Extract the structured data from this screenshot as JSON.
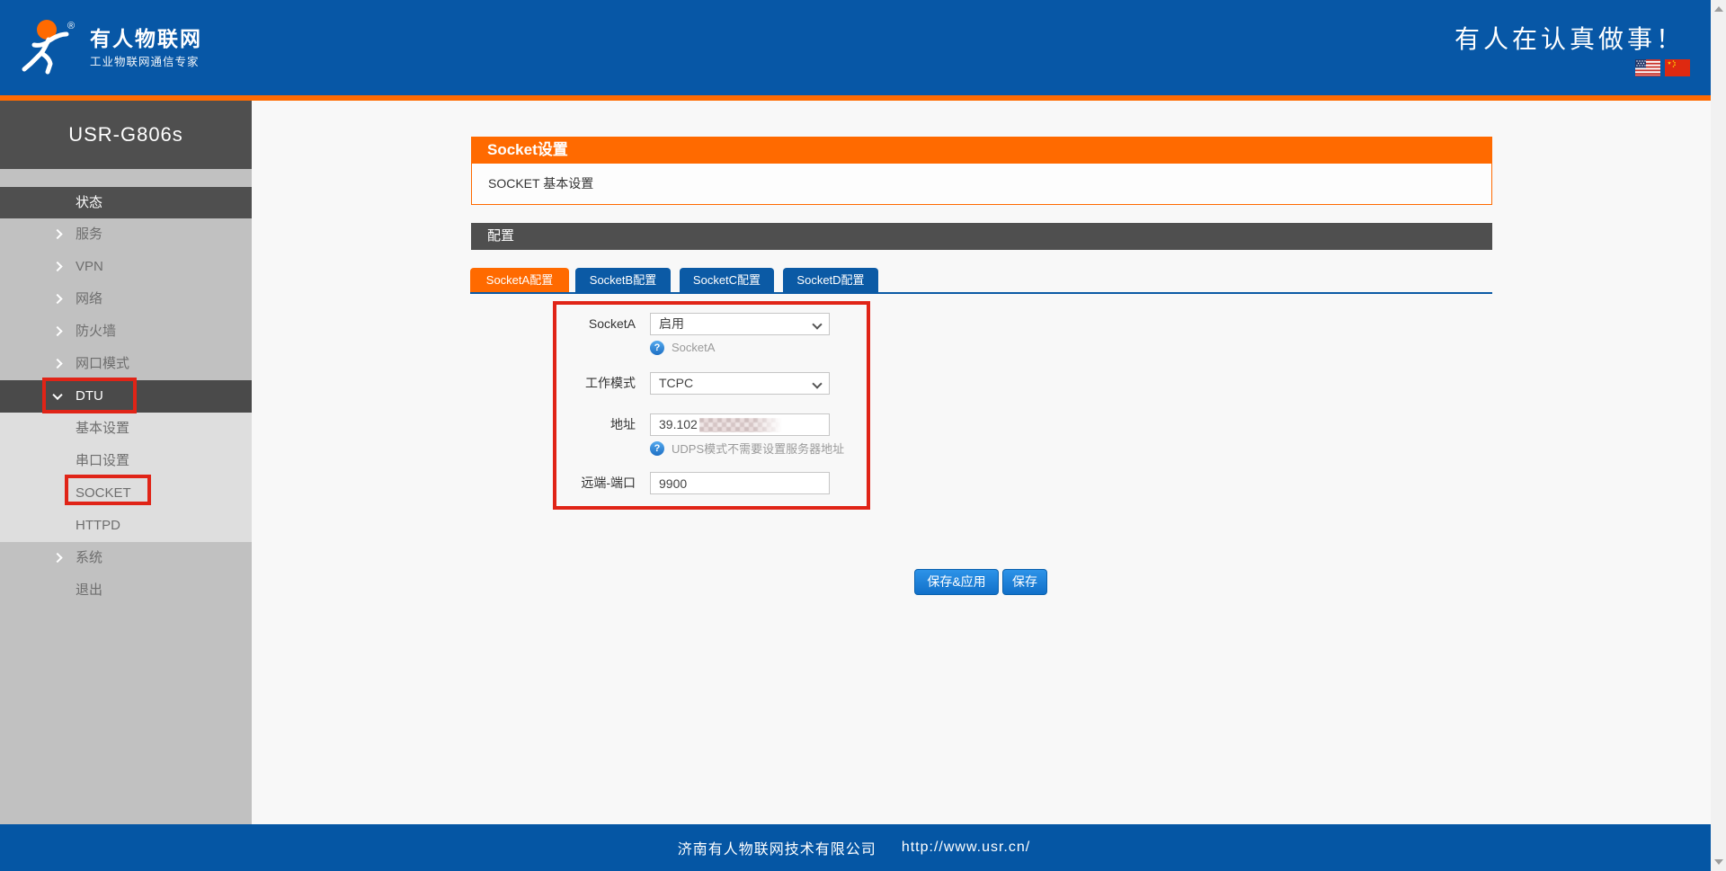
{
  "brand": {
    "name": "有人物联网",
    "subtitle": "工业物联网通信专家",
    "registered_mark": "®",
    "slogan": "有人在认真做事！"
  },
  "colors": {
    "header_blue": "#0757A6",
    "accent_orange": "#FF6A00",
    "dark_bar": "#4F4F4F",
    "tab_blue": "#0B5AA5",
    "annotation_red": "#E02417",
    "footer_blue": "#0556A4"
  },
  "sidebar": {
    "device_title": "USR-G806s",
    "items": [
      {
        "label": "状态"
      },
      {
        "label": "服务"
      },
      {
        "label": "VPN"
      },
      {
        "label": "网络"
      },
      {
        "label": "防火墙"
      },
      {
        "label": "网口模式"
      },
      {
        "label": "DTU"
      },
      {
        "label": "基本设置"
      },
      {
        "label": "串口设置"
      },
      {
        "label": "SOCKET"
      },
      {
        "label": "HTTPD"
      },
      {
        "label": "系统"
      },
      {
        "label": "退出"
      }
    ]
  },
  "main": {
    "panel_title": "Socket设置",
    "panel_subtitle": "SOCKET 基本设置",
    "config_title": "配置",
    "tabs": [
      {
        "label": "SocketA配置"
      },
      {
        "label": "SocketB配置"
      },
      {
        "label": "SocketC配置"
      },
      {
        "label": "SocketD配置"
      }
    ],
    "form": {
      "socket_enable": {
        "label": "SocketA",
        "value": "启用",
        "help": "SocketA"
      },
      "work_mode": {
        "label": "工作模式",
        "value": "TCPC"
      },
      "address": {
        "label": "地址",
        "value": "39.102",
        "help": "UDPS模式不需要设置服务器地址"
      },
      "remote_port": {
        "label": "远端-端口",
        "value": "9900"
      }
    },
    "buttons": {
      "save_apply": "保存&应用",
      "save": "保存"
    },
    "help_icon_glyph": "?"
  },
  "footer": {
    "company": "济南有人物联网技术有限公司",
    "url": "http://www.usr.cn/"
  }
}
